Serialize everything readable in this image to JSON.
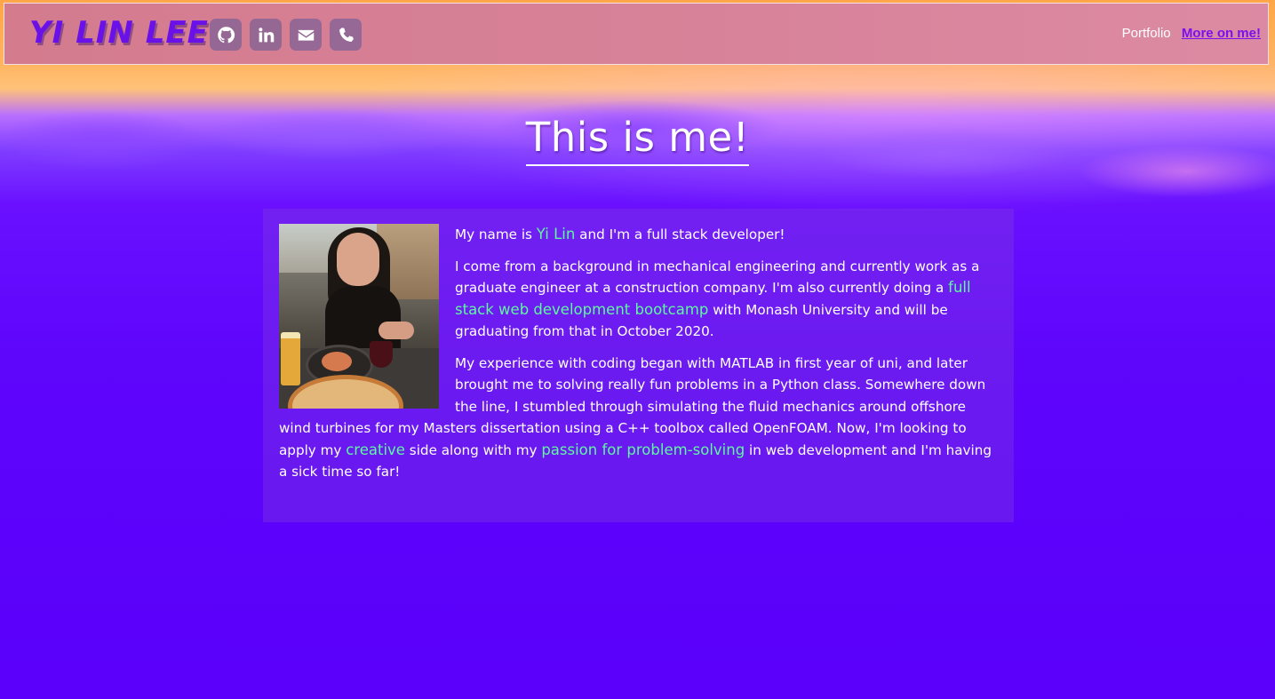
{
  "nav": {
    "brand": "YI LIN LEE",
    "socials": [
      {
        "icon": "github-icon"
      },
      {
        "icon": "linkedin-icon"
      },
      {
        "icon": "envelope-icon"
      },
      {
        "icon": "phone-icon"
      }
    ],
    "links": {
      "portfolio": "Portfolio",
      "more": "More on me!"
    }
  },
  "main": {
    "title": "This is me!",
    "photo_icon": "profile-photo",
    "p1": {
      "a": "My name is ",
      "name": "Yi Lin",
      "b": " and I'm a full stack developer!"
    },
    "p2": {
      "a": "I come from a background in mechanical engineering and currently work as a graduate engineer at a construction company. I'm also currently doing a ",
      "bootcamp": "full stack web development bootcamp",
      "b": " with Monash University and will be graduating from that in October 2020."
    },
    "p3": {
      "a": "My experience with coding began with MATLAB in first year of uni, and later brought me to solving really fun problems in a Python class. Somewhere down the line, I stumbled through simulating the fluid mechanics around offshore wind turbines for my Masters dissertation using a C++ toolbox called OpenFOAM. Now, I'm looking to apply my ",
      "creative": "creative",
      "b": " side along with my ",
      "passion": "passion for problem-solving",
      "c": " in web development and I'm having a sick time so far!"
    }
  },
  "colors": {
    "accent_green": "#5ff7a0",
    "brand_purple": "#6a10e8",
    "background_purple": "#5a00fb",
    "navbar_pink": "#d8839a"
  }
}
